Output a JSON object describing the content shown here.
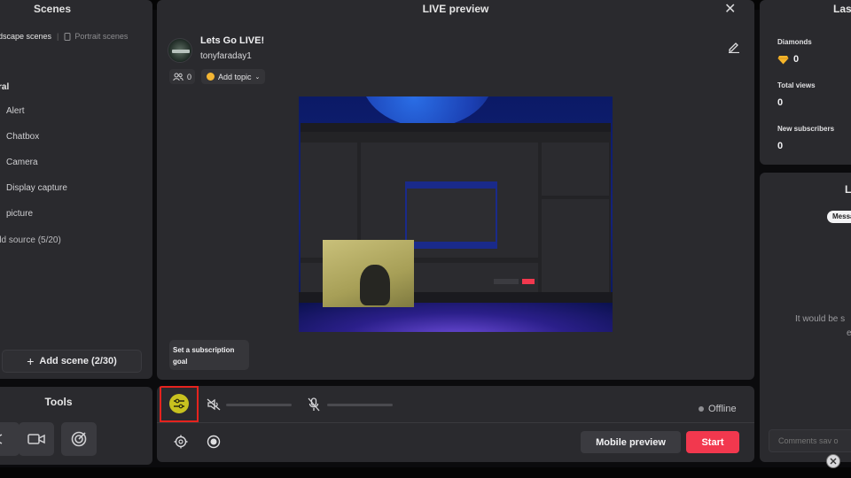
{
  "scenes": {
    "title": "Scenes",
    "tab_landscape": "dscape scenes",
    "tab_portrait": "Portrait scenes",
    "group": "ral",
    "sources": [
      "Alert",
      "Chatbox",
      "Camera",
      "Display capture",
      "picture"
    ],
    "add_source": "dd source (5/20)",
    "add_scene": "Add scene (2/30)"
  },
  "tools": {
    "title": "Tools"
  },
  "preview": {
    "title": "LIVE preview",
    "stream_title": "Lets Go LIVE!",
    "username": "tonyfaraday1",
    "viewer_count": "0",
    "add_topic": "Add topic",
    "sub_goal": "Set a subscription goal"
  },
  "controls": {
    "status": "Offline",
    "mobile_preview": "Mobile preview",
    "start": "Start"
  },
  "stats": {
    "title": "Las",
    "diamonds_label": "Diamonds",
    "diamonds_value": "0",
    "views_label": "Total views",
    "views_value": "0",
    "subs_label": "New subscribers",
    "subs_value": "0"
  },
  "chat": {
    "title": "L",
    "messages_tab": "Messa",
    "empty_line1": "It would be s",
    "empty_line2": "e",
    "comment_placeholder": "Comments sav o"
  },
  "colors": {
    "panel": "#2a2a2e",
    "accent_start": "#f2384e",
    "mixer_active": "#c8c21f",
    "highlight": "#e5231e"
  }
}
